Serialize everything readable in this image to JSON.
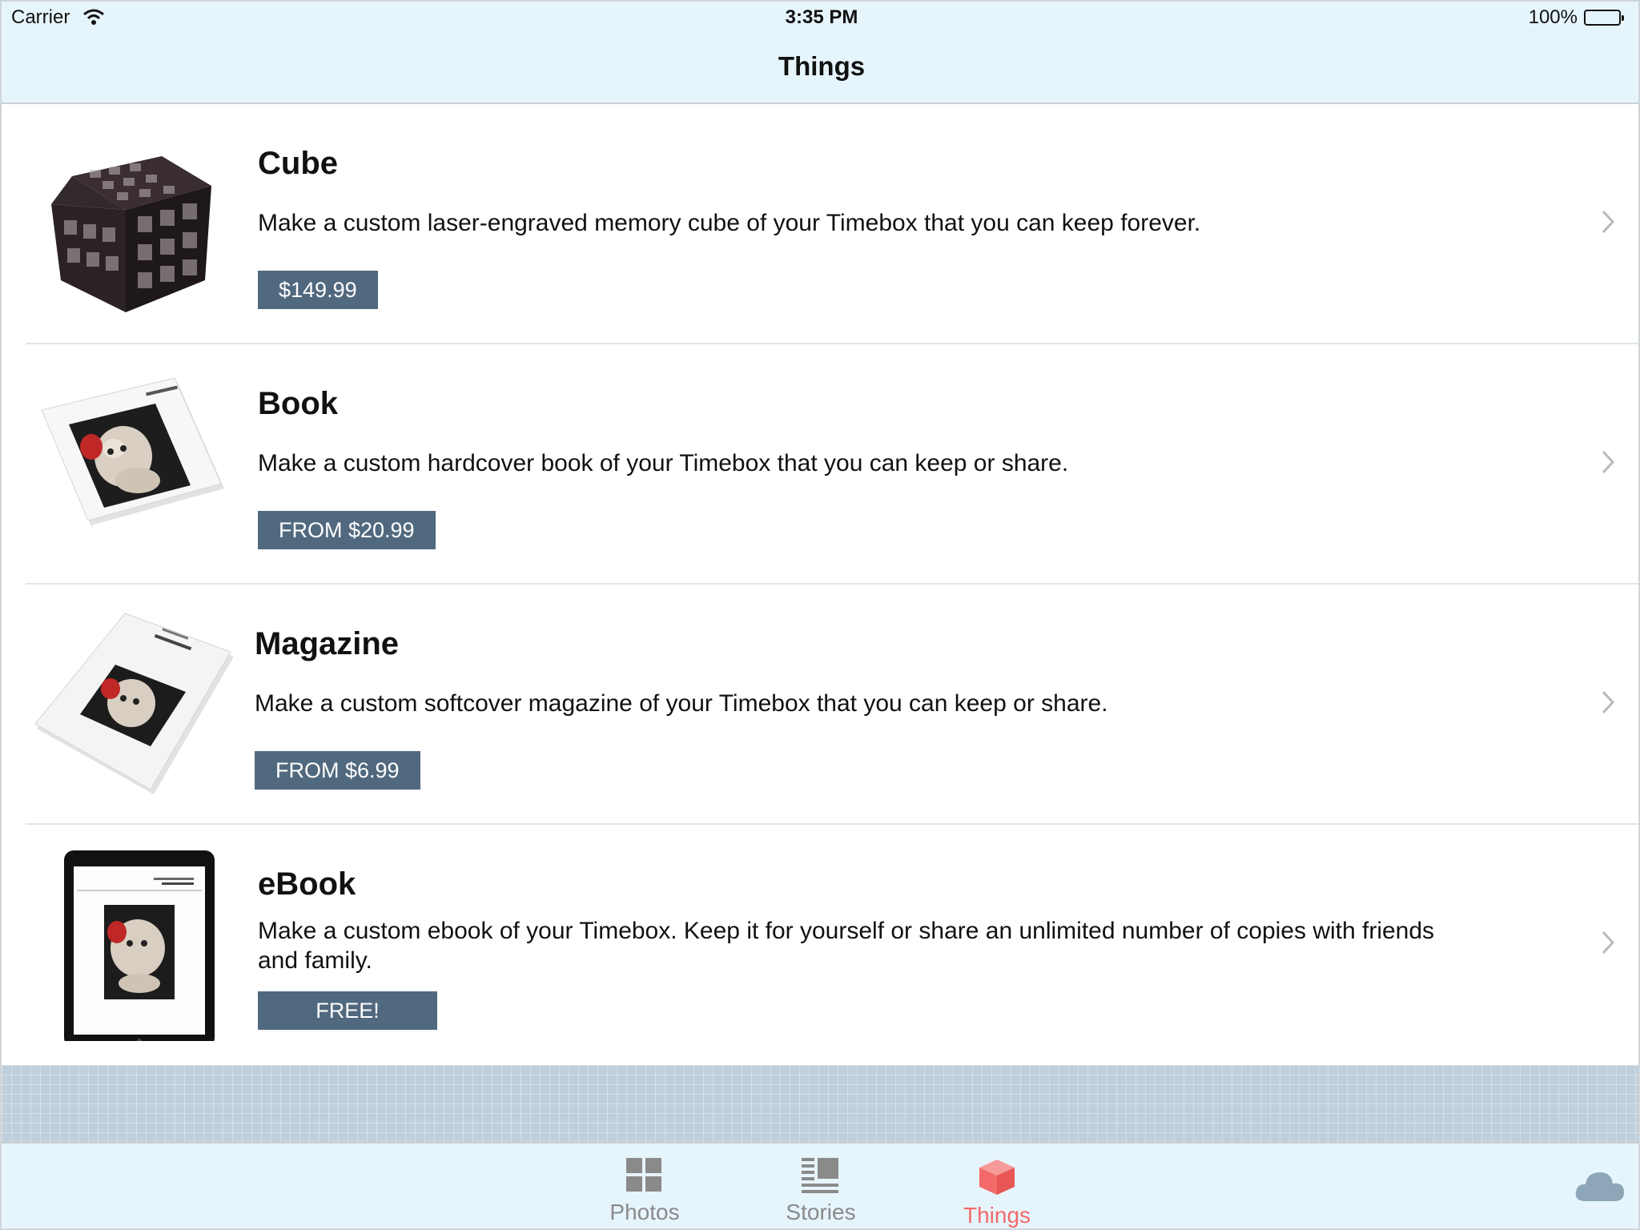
{
  "status_bar": {
    "carrier": "Carrier",
    "time": "3:35 PM",
    "battery": "100%"
  },
  "nav": {
    "title": "Things"
  },
  "items": [
    {
      "title": "Cube",
      "description": "Make a custom laser-engraved memory cube of your Timebox that you can keep forever.",
      "price": "$149.99",
      "thumbnail": "cube-image"
    },
    {
      "title": "Book",
      "description": "Make a custom hardcover book of your Timebox that you can keep or share.",
      "price": "FROM $20.99",
      "thumbnail": "book-image"
    },
    {
      "title": "Magazine",
      "description": "Make a custom softcover magazine of your Timebox that you can keep or share.",
      "price": "FROM $6.99",
      "thumbnail": "magazine-image"
    },
    {
      "title": "eBook",
      "description": "Make a custom ebook of your Timebox. Keep it for yourself or share an unlimited number of copies with friends and family.",
      "price": "FREE!",
      "thumbnail": "tablet-image"
    }
  ],
  "tabs": [
    {
      "label": "Photos",
      "icon": "grid-icon",
      "active": false
    },
    {
      "label": "Stories",
      "icon": "stories-icon",
      "active": false
    },
    {
      "label": "Things",
      "icon": "box-icon",
      "active": true
    }
  ],
  "colors": {
    "accent": "#f46a6a",
    "price_button": "#51697f",
    "bar_background": "#e6f5fb"
  }
}
